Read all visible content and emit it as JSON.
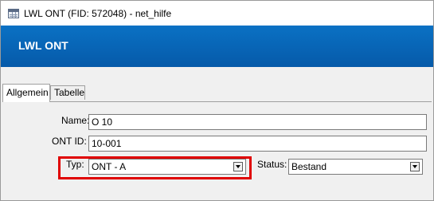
{
  "window": {
    "title": "LWL ONT (FID: 572048) - net_hilfe",
    "title_icon": "table-icon"
  },
  "banner": {
    "title": "LWL ONT",
    "color": "#0a6bbf"
  },
  "tabs": [
    {
      "label": "Allgemein",
      "active": true
    },
    {
      "label": "Tabelle",
      "active": false
    }
  ],
  "form": {
    "name": {
      "label": "Name:",
      "value": "O 10"
    },
    "ont_id": {
      "label": "ONT ID:",
      "value": "10-001"
    },
    "typ": {
      "label": "Typ:",
      "value": "ONT - A"
    },
    "status": {
      "label": "Status:",
      "value": "Bestand"
    }
  },
  "highlight_color": "#e00000"
}
